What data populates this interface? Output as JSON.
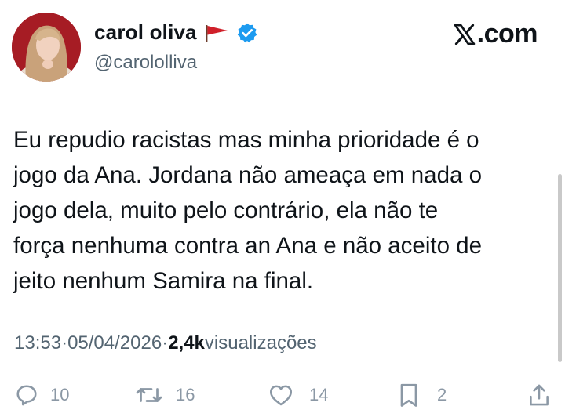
{
  "author": {
    "name": "carol oliva",
    "handle": "@carololliva",
    "flag_icon": "red-flag-icon",
    "verified_icon": "verified-badge-icon",
    "verified_color": "#1d9bf0"
  },
  "brand": {
    "label": ".com",
    "icon": "x-logo-icon"
  },
  "tweet": {
    "text": "Eu repudio racistas mas minha prioridade é o\njogo da Ana. Jordana não ameaça em nada o\njogo dela, muito pelo contrário, ela não te\nforça nenhuma contra an Ana e não aceito de\njeito nenhum Samira na final."
  },
  "meta": {
    "time": "13:53",
    "sep1": " · ",
    "date": "05/04/2026",
    "sep2": " · ",
    "views_count": "2,4k",
    "views_label": " visualizações"
  },
  "actions": {
    "reply": {
      "icon": "reply-icon",
      "count": "10"
    },
    "repost": {
      "icon": "repost-icon",
      "count": "16"
    },
    "like": {
      "icon": "heart-icon",
      "count": "14"
    },
    "bookmark": {
      "icon": "bookmark-icon",
      "count": "2"
    },
    "share": {
      "icon": "share-icon"
    }
  },
  "colors": {
    "text": "#0f1419",
    "secondary": "#536471",
    "action_gray": "#8b98a5",
    "avatar_bg": "#a61c24",
    "flag_red": "#d0202a"
  }
}
